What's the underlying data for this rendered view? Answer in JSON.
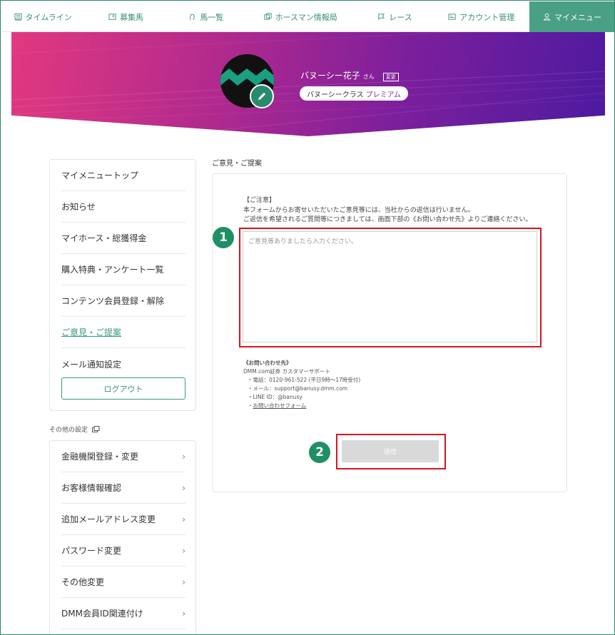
{
  "nav": {
    "items": [
      {
        "label": "タイムライン",
        "icon": "timeline-icon"
      },
      {
        "label": "募集馬",
        "icon": "horse-card-icon"
      },
      {
        "label": "馬一覧",
        "icon": "horse-list-icon"
      },
      {
        "label": "ホースマン情報局",
        "icon": "info-bureau-icon"
      },
      {
        "label": "レース",
        "icon": "race-flag-icon"
      },
      {
        "label": "アカウント管理",
        "icon": "account-card-icon"
      },
      {
        "label": "マイメニュー",
        "icon": "user-icon"
      }
    ],
    "active_index": 6
  },
  "profile": {
    "name": "バヌーシー花子",
    "honorific": "さん",
    "change_label": "変更",
    "class_label": "バヌーシークラス",
    "class_tier": "プレミアム"
  },
  "sidebar": {
    "items": [
      {
        "label": "マイメニュートップ"
      },
      {
        "label": "お知らせ"
      },
      {
        "label": "マイホース・総獲得金"
      },
      {
        "label": "購入特典・アンケート一覧"
      },
      {
        "label": "コンテンツ会員登録・解除"
      },
      {
        "label": "ご意見・ご提案"
      },
      {
        "label": "メール通知設定"
      }
    ],
    "current_index": 5,
    "logout_label": "ログアウト"
  },
  "other": {
    "label": "その他の設定",
    "items": [
      {
        "label": "金融機関登録・変更"
      },
      {
        "label": "お客様情報確認"
      },
      {
        "label": "追加メールアドレス変更"
      },
      {
        "label": "パスワード変更"
      },
      {
        "label": "その他変更"
      },
      {
        "label": "DMM会員ID関連付け"
      }
    ]
  },
  "main": {
    "title": "ご意見・ご提案",
    "notice": [
      "【ご注意】",
      "本フォームからお寄せいただいたご意見等には、当社からの返信は行いません。",
      "ご返信を希望されるご質問等につきましては、画面下部の《お問い合わせ先》よりご連絡ください。"
    ],
    "textarea_placeholder": "ご意見等ありましたら入力ください。",
    "contact": {
      "heading": "《お問い合わせ先》",
      "company": "DMM.com証券 カスタマーサポート",
      "phone": "・電話：0120-961-522 (平日9時～17時受付)",
      "email": "・メール：support@banusy.dmm.com",
      "line": "・LINE ID：@banusy",
      "form_bullet": "・",
      "form_link": "お問い合わせフォーム"
    },
    "submit_label": "送信",
    "badges": [
      "1",
      "2"
    ]
  },
  "colors": {
    "accent": "#3a9a7c",
    "nav_active": "#4aa085",
    "highlight": "#d9141b",
    "badge": "#1f8f66"
  }
}
